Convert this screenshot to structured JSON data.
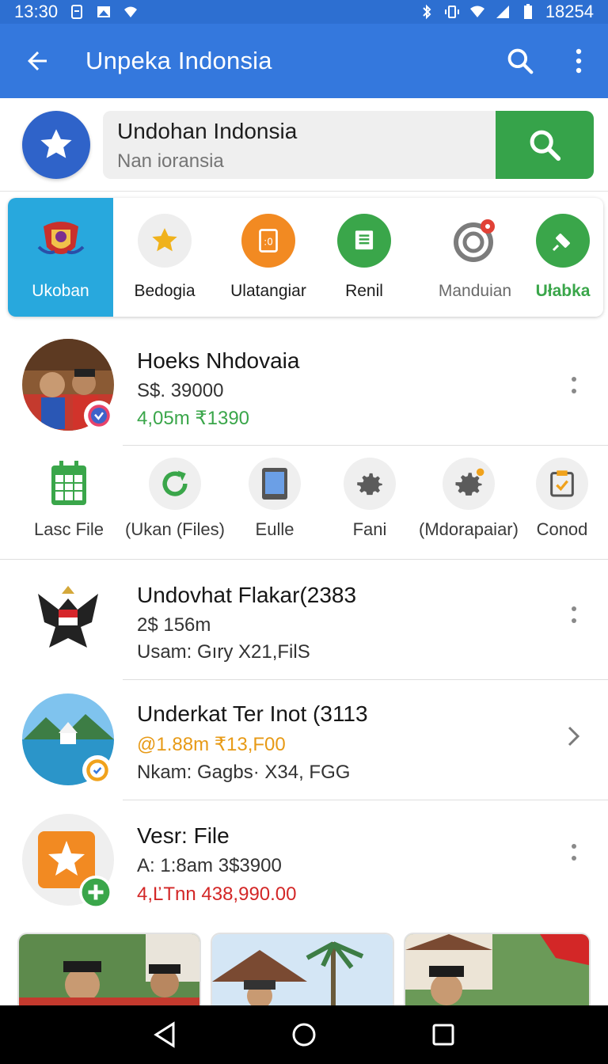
{
  "status_bar": {
    "time": "13:30",
    "right_text": "18254"
  },
  "app_bar": {
    "title": "Unpeka Indonsia",
    "back_icon": "arrow-back-icon",
    "search_icon": "search-icon",
    "more_icon": "more-vert-icon"
  },
  "search": {
    "query": "Undohan Indonsia",
    "placeholder": "Nan ioransia"
  },
  "categories": [
    {
      "label": "Ukoban",
      "active": true
    },
    {
      "label": "Bedogia"
    },
    {
      "label": "Ulatangiar"
    },
    {
      "label": "Renil"
    },
    {
      "label": "Manduian"
    },
    {
      "label": "Ułabka"
    }
  ],
  "list": [
    {
      "title": "Hoeks Nhdovaia",
      "line2": "S$. 39000",
      "line3": "4,05m ₹1390",
      "line3_color": "#3aa64a"
    },
    {
      "title": "Undovhat Flakar(2383",
      "line2": "2$ 156m",
      "line3": "Usam: Gıry X21,FilS"
    },
    {
      "title": "Underkat Ter Inot (3113",
      "line2": "@1.88m ₹13,F00",
      "line2_color": "#e79a16",
      "line3": "Nkam: Gagbs· X34, FGG"
    },
    {
      "title": "Vesr: File",
      "line2": "A:  1:8am 3$3900",
      "line3": "4,ĽTnn  438,990.00",
      "line3_color": "#d32727"
    }
  ],
  "quick_actions": [
    {
      "label": "Lasc File",
      "icon": "calendar-icon"
    },
    {
      "label": "(Ukan (Files)",
      "icon": "refresh-icon"
    },
    {
      "label": "Eulle",
      "icon": "tablet-icon"
    },
    {
      "label": "Fani",
      "icon": "gear-icon"
    },
    {
      "label": "(Mdorapaiar)",
      "icon": "settings-badge-icon"
    },
    {
      "label": "Conod",
      "icon": "clipboard-check-icon"
    }
  ],
  "colors": {
    "app_bar": "#3478dd",
    "status_bar": "#2d6fd1",
    "search_button": "#36a34a",
    "active_category": "#28a8dd"
  }
}
